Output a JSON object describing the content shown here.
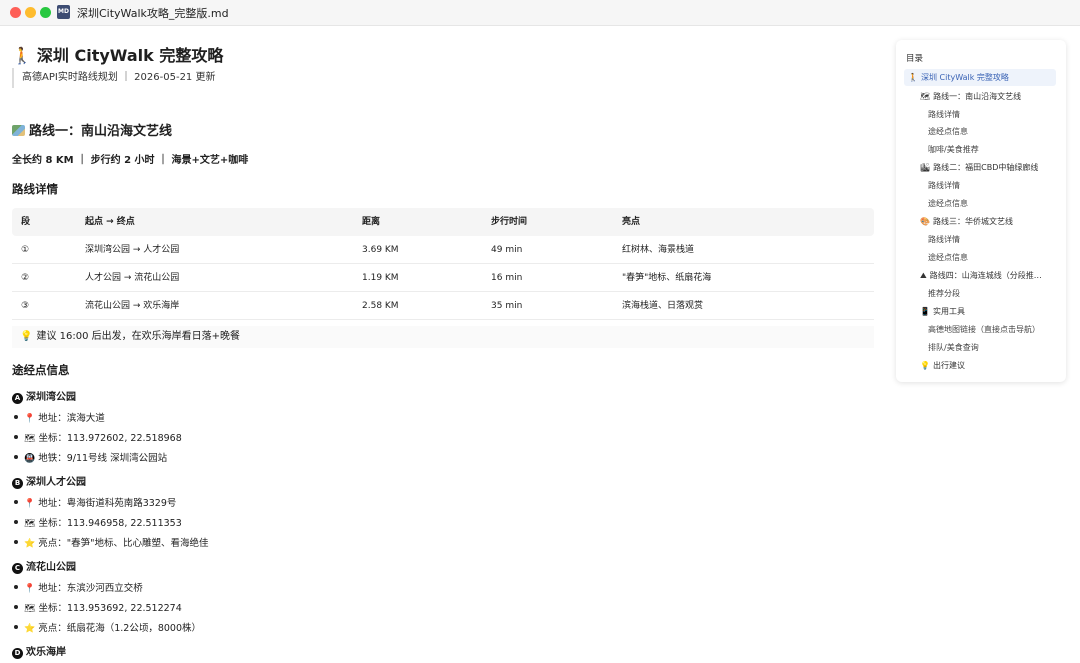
{
  "window": {
    "title": "深圳CityWalk攻略_完整版.md",
    "file_icon": "md-file-icon",
    "file_icon_text": "MD"
  },
  "doc": {
    "title_icon": "🚶",
    "title": "深圳 CityWalk 完整攻略",
    "subtitle": "高德API实时路线规划 ｜ 2026-05-21 更新",
    "route1": {
      "heading": "路线一：南山沿海文艺线",
      "meta": "全长约 8 KM ｜ 步行约 2 小时 ｜ 海景+文艺+咖啡",
      "details_heading": "路线详情",
      "table": {
        "headers": [
          "段",
          "起点 → 终点",
          "距离",
          "步行时间",
          "亮点"
        ],
        "rows": [
          [
            "①",
            "深圳湾公园 → 人才公园",
            "3.69 KM",
            "49 min",
            "红树林、海景栈道"
          ],
          [
            "②",
            "人才公园 → 流花山公园",
            "1.19 KM",
            "16 min",
            "\"春笋\"地标、纸扇花海"
          ],
          [
            "③",
            "流花山公园 → 欢乐海岸",
            "2.58 KM",
            "35 min",
            "滨海栈道、日落观赏"
          ]
        ]
      },
      "tip": "建议 16:00 后出发，在欢乐海岸看日落+晚餐",
      "poi_heading": "途经点信息",
      "pois": [
        {
          "badge": "A",
          "name": "深圳湾公园",
          "items": [
            {
              "icon": "📍",
              "text": "地址：滨海大道"
            },
            {
              "icon": "🗺",
              "text": "坐标：113.972602, 22.518968"
            },
            {
              "icon": "🚇",
              "text": "地铁：9/11号线 深圳湾公园站"
            }
          ]
        },
        {
          "badge": "B",
          "name": "深圳人才公园",
          "items": [
            {
              "icon": "📍",
              "text": "地址：粤海街道科苑南路3329号"
            },
            {
              "icon": "🗺",
              "text": "坐标：113.946958, 22.511353"
            },
            {
              "icon": "⭐",
              "text": "亮点：\"春笋\"地标、比心雕塑、看海绝佳"
            }
          ]
        },
        {
          "badge": "C",
          "name": "流花山公园",
          "items": [
            {
              "icon": "📍",
              "text": "地址：东滨沙河西立交桥"
            },
            {
              "icon": "🗺",
              "text": "坐标：113.953692, 22.512274"
            },
            {
              "icon": "⭐",
              "text": "亮点：纸扇花海（1.2公顷，8000株）"
            }
          ]
        },
        {
          "badge": "D",
          "name": "欢乐海岸",
          "items": []
        }
      ]
    }
  },
  "toc": {
    "title": "目录",
    "items": [
      {
        "icon": "🚶",
        "label": "深圳 CityWalk 完整攻略"
      },
      {
        "icon": "🗺",
        "label": "路线一：南山沿海文艺线"
      },
      {
        "icon": "",
        "label": "路线详情"
      },
      {
        "icon": "",
        "label": "途经点信息"
      },
      {
        "icon": "",
        "label": "咖啡/美食推荐"
      },
      {
        "icon": "🏙",
        "label": "路线二：福田CBD中轴绿廊线"
      },
      {
        "icon": "",
        "label": "路线详情"
      },
      {
        "icon": "",
        "label": "途经点信息"
      },
      {
        "icon": "🎨",
        "label": "路线三：华侨城文艺线"
      },
      {
        "icon": "",
        "label": "路线详情"
      },
      {
        "icon": "",
        "label": "途经点信息"
      },
      {
        "icon": "⛰",
        "label": "路线四：山海连城线（分段推…"
      },
      {
        "icon": "",
        "label": "推荐分段"
      },
      {
        "icon": "📱",
        "label": "实用工具"
      },
      {
        "icon": "",
        "label": "高德地图链接（直接点击导航）"
      },
      {
        "icon": "",
        "label": "排队/美食查询"
      },
      {
        "icon": "💡",
        "label": "出行建议"
      }
    ]
  },
  "colors": {
    "toc_active_bg": "#eef3fb",
    "toc_active_text": "#3a63b5",
    "close": "#fe5f57",
    "minimize": "#febc2e",
    "zoom": "#28c840"
  }
}
